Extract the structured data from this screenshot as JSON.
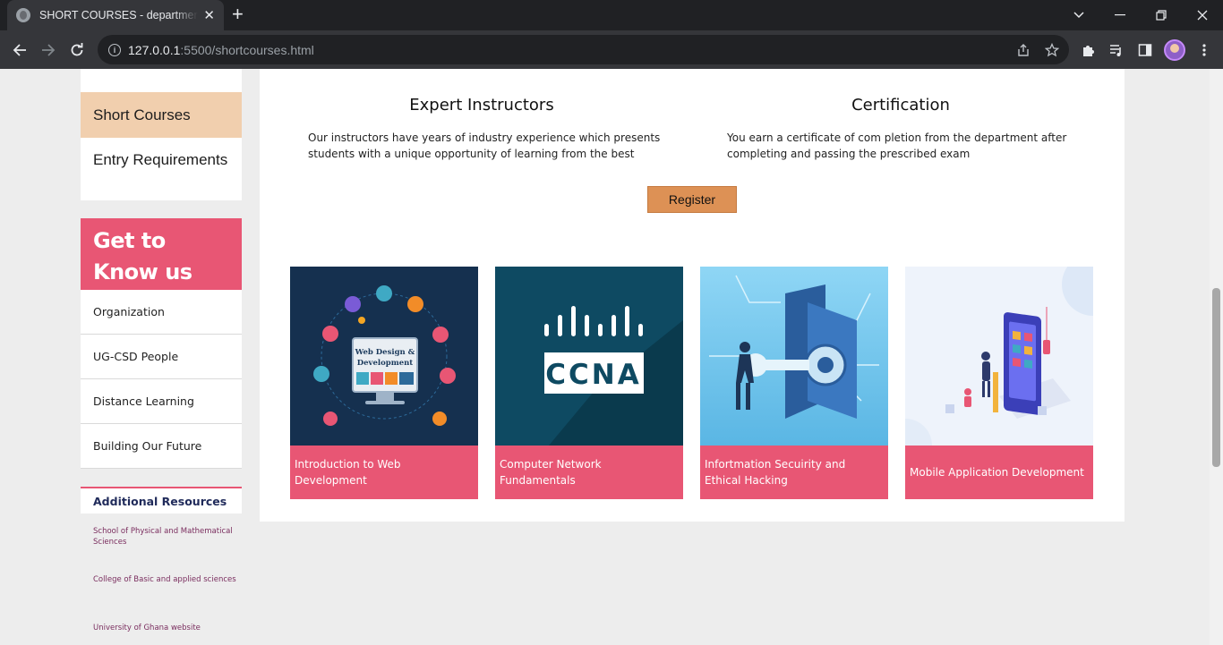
{
  "browser": {
    "tab_title": "SHORT COURSES - department of",
    "tab_close": "✕",
    "new_tab": "+",
    "url_host": "127.0.0.1",
    "url_path": ":5500/shortcourses.html"
  },
  "sidebar": {
    "menu": [
      {
        "label": "Short Courses",
        "active": true
      },
      {
        "label": "Entry Requirements",
        "active": false
      }
    ],
    "get_to_know": {
      "heading": "Get to Know us",
      "items": [
        "Organization",
        "UG-CSD People",
        "Distance Learning",
        "Building Our Future"
      ]
    },
    "additional_resources": {
      "heading": "Additional Resources",
      "links": [
        "School of Physical and Mathematical Sciences",
        "College of Basic and applied sciences",
        "University of Ghana website"
      ]
    }
  },
  "main": {
    "features": [
      {
        "title": "Expert Instructors",
        "text": "Our instructors have years of industry experience which presents students with a unique opportunity of learning from the best"
      },
      {
        "title": "Certification",
        "text": "You earn a certificate of com pletion from the department after completing and passing the prescribed exam"
      }
    ],
    "register_label": "Register",
    "courses": [
      {
        "title": "Introduction to Web Development",
        "image": "web-design-illustration",
        "image_text": "Web Design & Development"
      },
      {
        "title": "Computer Network Fundamentals",
        "image": "ccna-logo",
        "image_text": "CCNA"
      },
      {
        "title": "Infortmation Secuirity and Ethical Hacking",
        "image": "security-key-illustration"
      },
      {
        "title": "Mobile Application Development",
        "image": "mobile-app-illustration"
      }
    ]
  },
  "colors": {
    "accent_pink": "#e85674",
    "active_menu": "#f1cfae",
    "register_button": "#dd9155"
  }
}
